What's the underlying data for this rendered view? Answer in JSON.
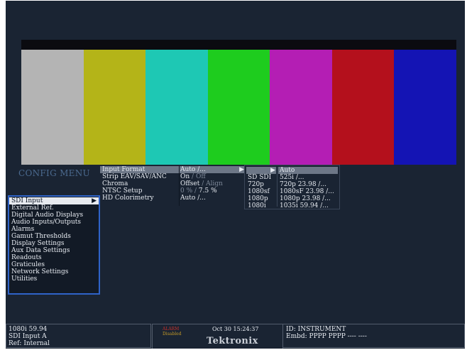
{
  "colors": {
    "screen_bg": "#1a2433",
    "highlight": "#6d7787",
    "menu_border": "#2f63c8",
    "alarm": "#c8302a"
  },
  "color_bars": [
    "#b4b4b4",
    "#b4b418",
    "#1ec8b4",
    "#1ecc1e",
    "#b41eb4",
    "#b4101c",
    "#1414b4"
  ],
  "config_menu": {
    "title": "CONFIG MENU",
    "items": [
      {
        "label": "SDI Input",
        "selected": true
      },
      {
        "label": "External Ref."
      },
      {
        "label": "Digital Audio Displays"
      },
      {
        "label": "Audio Inputs/Outputs"
      },
      {
        "label": "Alarms"
      },
      {
        "label": "Gamut Thresholds"
      },
      {
        "label": "Display Settings"
      },
      {
        "label": "Aux Data Settings"
      },
      {
        "label": "Readouts"
      },
      {
        "label": "Graticules"
      },
      {
        "label": "Network Settings"
      },
      {
        "label": "Utilities"
      }
    ],
    "arrow_icon": "right-triangle-icon"
  },
  "sdi_input_submenu": [
    {
      "label": "Input Format",
      "value": "Auto /...",
      "selected": true
    },
    {
      "label": "Strip EAV/SAV/ANC",
      "value_on": "On",
      "value_sep": " / ",
      "value_off": "Off"
    },
    {
      "label": "Chroma",
      "value_on": "Offset",
      "value_sep": " / ",
      "value_off": "Align"
    },
    {
      "label": "NTSC Setup",
      "value_off": "0 %",
      "value_sep": " / ",
      "value_on": "7.5 %"
    },
    {
      "label": "HD Colorimetry",
      "value": "Auto /..."
    }
  ],
  "format_panel": {
    "left": [
      "",
      "SD SDI",
      "720p",
      "1080sf",
      "1080p",
      "1080i"
    ],
    "right": [
      "Auto",
      "525i /...",
      "720p 23.98 /...",
      "1080sF 23.98 /...",
      "1080p 23.98 /...",
      "1035i 59.94 /..."
    ]
  },
  "status_bar": {
    "left_lines": [
      "1080i 59.94",
      "SDI Input A",
      "Ref: Internal"
    ],
    "alarm_line1": "ALARM",
    "alarm_line2": "Disabled",
    "timestamp": "Oct 30 15:24:37",
    "brand": "Tektronix",
    "id_line": "ID: INSTRUMENT",
    "embd_line": "Embd: PPPP PPPP ---- ----"
  }
}
